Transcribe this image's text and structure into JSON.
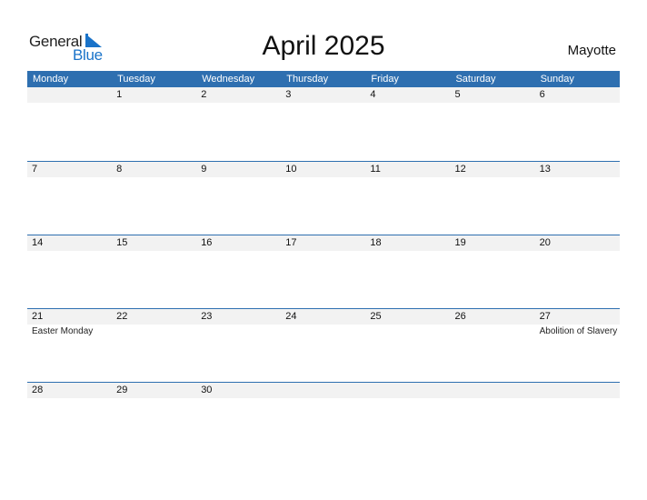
{
  "logo": {
    "part1": "General",
    "part2": "Blue"
  },
  "title": "April 2025",
  "country": "Mayotte",
  "weekdays": [
    "Monday",
    "Tuesday",
    "Wednesday",
    "Thursday",
    "Friday",
    "Saturday",
    "Sunday"
  ],
  "weeks": [
    {
      "days": [
        {
          "day": "",
          "holiday": ""
        },
        {
          "day": "1",
          "holiday": ""
        },
        {
          "day": "2",
          "holiday": ""
        },
        {
          "day": "3",
          "holiday": ""
        },
        {
          "day": "4",
          "holiday": ""
        },
        {
          "day": "5",
          "holiday": ""
        },
        {
          "day": "6",
          "holiday": ""
        }
      ]
    },
    {
      "days": [
        {
          "day": "7",
          "holiday": ""
        },
        {
          "day": "8",
          "holiday": ""
        },
        {
          "day": "9",
          "holiday": ""
        },
        {
          "day": "10",
          "holiday": ""
        },
        {
          "day": "11",
          "holiday": ""
        },
        {
          "day": "12",
          "holiday": ""
        },
        {
          "day": "13",
          "holiday": ""
        }
      ]
    },
    {
      "days": [
        {
          "day": "14",
          "holiday": ""
        },
        {
          "day": "15",
          "holiday": ""
        },
        {
          "day": "16",
          "holiday": ""
        },
        {
          "day": "17",
          "holiday": ""
        },
        {
          "day": "18",
          "holiday": ""
        },
        {
          "day": "19",
          "holiday": ""
        },
        {
          "day": "20",
          "holiday": ""
        }
      ]
    },
    {
      "days": [
        {
          "day": "21",
          "holiday": "Easter Monday"
        },
        {
          "day": "22",
          "holiday": ""
        },
        {
          "day": "23",
          "holiday": ""
        },
        {
          "day": "24",
          "holiday": ""
        },
        {
          "day": "25",
          "holiday": ""
        },
        {
          "day": "26",
          "holiday": ""
        },
        {
          "day": "27",
          "holiday": "Abolition of Slavery"
        }
      ]
    },
    {
      "days": [
        {
          "day": "28",
          "holiday": ""
        },
        {
          "day": "29",
          "holiday": ""
        },
        {
          "day": "30",
          "holiday": ""
        },
        {
          "day": "",
          "holiday": ""
        },
        {
          "day": "",
          "holiday": ""
        },
        {
          "day": "",
          "holiday": ""
        },
        {
          "day": "",
          "holiday": ""
        }
      ]
    }
  ],
  "colors": {
    "accent": "#2e6fb0",
    "brand_blue": "#1a73c9",
    "date_strip": "#f2f2f2"
  }
}
